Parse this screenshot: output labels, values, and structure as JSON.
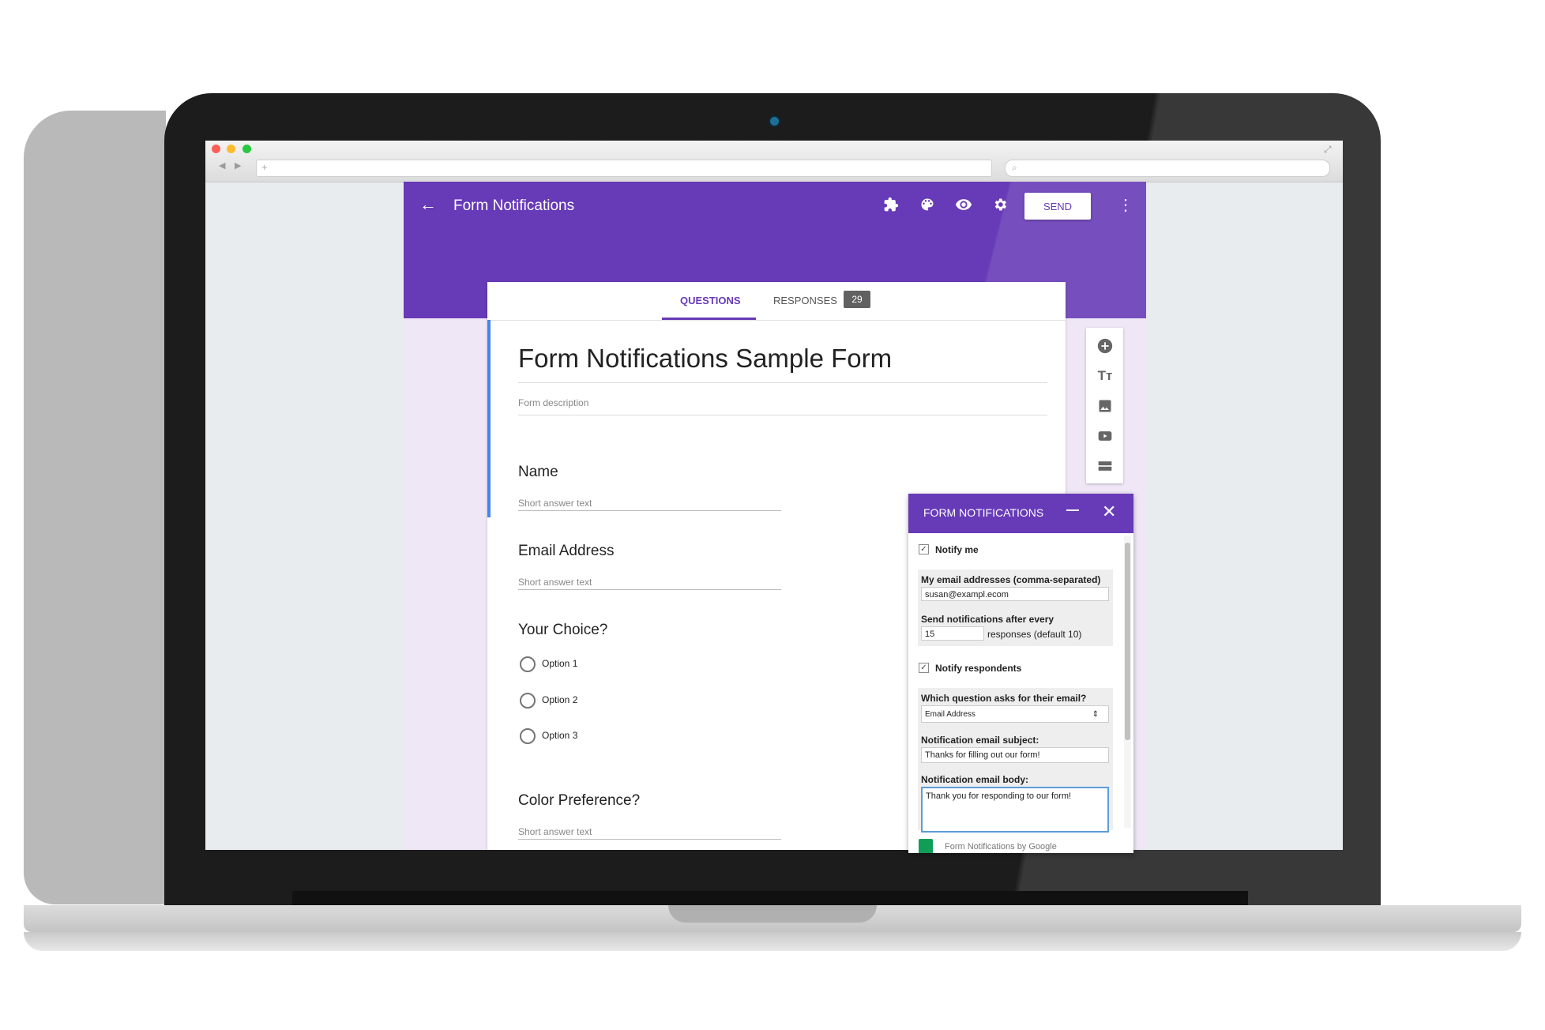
{
  "app": {
    "title": "Form Notifications",
    "send_label": "SEND",
    "accent": "#673ab7"
  },
  "icons": {
    "back": "arrow-left-icon",
    "addons": "puzzle-icon",
    "palette": "palette-icon",
    "preview": "eye-icon",
    "settings": "gear-icon",
    "more": "more-vert-icon"
  },
  "tabs": {
    "questions": "QUESTIONS",
    "responses": "RESPONSES",
    "responses_count": "29"
  },
  "form": {
    "title": "Form Notifications Sample Form",
    "description_placeholder": "Form description",
    "questions": [
      {
        "label": "Name",
        "placeholder": "Short answer text"
      },
      {
        "label": "Email Address",
        "placeholder": "Short answer text"
      },
      {
        "label": "Your Choice?",
        "options": [
          "Option 1",
          "Option 2",
          "Option 3"
        ]
      },
      {
        "label": "Color Preference?",
        "placeholder": "Short answer text"
      }
    ]
  },
  "sidebar": [
    "add-question-icon",
    "title-text-icon",
    "image-icon",
    "video-icon",
    "section-icon"
  ],
  "panel": {
    "title": "FORM NOTIFICATIONS",
    "notify_me": "Notify me",
    "notify_me_checked": true,
    "emails_label": "My email addresses (comma-separated)",
    "emails_value": "susan@exampl.ecom",
    "after_label": "Send notifications after every",
    "after_value": "15",
    "after_suffix": "responses (default 10)",
    "notify_respondents": "Notify respondents",
    "notify_respondents_checked": true,
    "which_question_label": "Which question asks for their email?",
    "which_question_value": "Email Address",
    "subject_label": "Notification email subject:",
    "subject_value": "Thanks for filling out our form!",
    "body_label": "Notification email body:",
    "body_value": "Thank you for responding to our form!",
    "footer": "Form Notifications by Google"
  }
}
